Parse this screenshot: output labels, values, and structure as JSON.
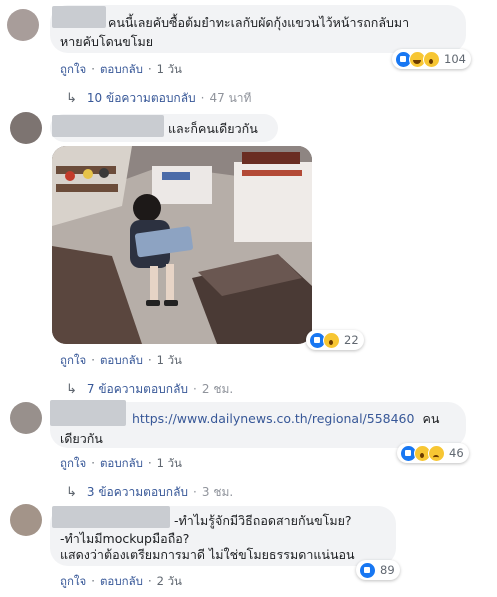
{
  "comments": [
    {
      "text_lines": [
        "คนนี้เลยคับซื้อต้มยำทะเลกับผัดกุ้งแขวนไว้หน้ารถกลับมา",
        "หายคับโดนขโมย"
      ],
      "actions": {
        "like": "ถูกใจ",
        "reply": "ตอบกลับ",
        "time": "1 วัน"
      },
      "reactions": {
        "count": "104",
        "icons": [
          "like-icon",
          "haha-icon",
          "wow-icon"
        ]
      },
      "replies": {
        "label": "10 ข้อความตอบกลับ",
        "time": "47 นาที"
      }
    },
    {
      "text_lines": [
        "และก็คนเดียวกัน"
      ],
      "actions": {
        "like": "ถูกใจ",
        "reply": "ตอบกลับ",
        "time": "1 วัน"
      },
      "reactions": {
        "count": "22",
        "icons": [
          "like-icon",
          "wow-icon"
        ]
      },
      "replies": {
        "label": "7 ข้อความตอบกลับ",
        "time": "2 ชม."
      }
    },
    {
      "link": "https://www.dailynews.co.th/regional/558460",
      "text_after_link": "คน",
      "text_line2": "เดียวกัน",
      "actions": {
        "like": "ถูกใจ",
        "reply": "ตอบกลับ",
        "time": "1 วัน"
      },
      "reactions": {
        "count": "46",
        "icons": [
          "like-icon",
          "wow-icon",
          "sad-icon"
        ]
      },
      "replies": {
        "label": "3 ข้อความตอบกลับ",
        "time": "3 ชม."
      }
    },
    {
      "text_lines": [
        "-ทำไมรู้จักมีวิธีถอดสายกันขโมย?",
        "-ทำไมมีmockupมือถือ?",
        "แสดงว่าต้องเตรียมการมาดี ไม่ใช่ขโมยธรรมดาแน่นอน"
      ],
      "actions": {
        "like": "ถูกใจ",
        "reply": "ตอบกลับ",
        "time": "2 วัน"
      },
      "reactions": {
        "count": "89",
        "icons": [
          "like-icon"
        ]
      }
    }
  ],
  "colors": {
    "link": "#385898",
    "bubble": "#f2f3f5",
    "meta": "#606770",
    "like": "#1877f2",
    "emoji": "#f7c633"
  }
}
